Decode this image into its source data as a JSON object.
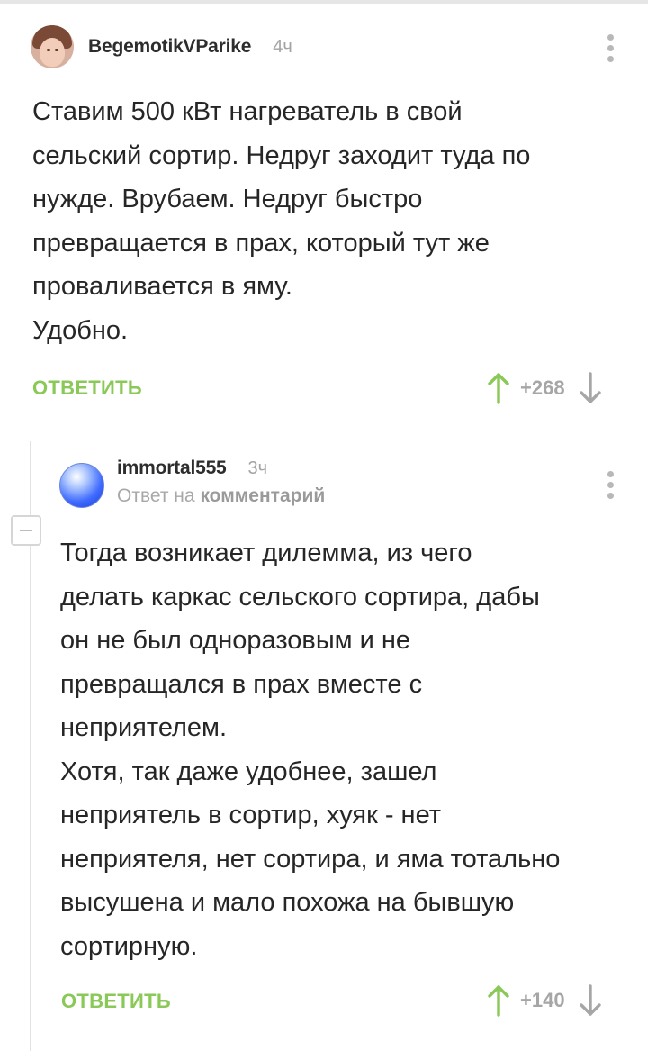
{
  "comment1": {
    "username": "BegemotikVParike",
    "time": "4ч",
    "text": "Ставим 500 кВт нагреватель в свой\nсельский сортир. Недруг заходит туда по\nнужде. Врубаем. Недруг быстро\nпревращается в прах, который тут же\nпроваливается в яму.\nУдобно.",
    "reply_label": "ОТВЕТИТЬ",
    "rating": "+268"
  },
  "comment2": {
    "username": "immortal555",
    "time": "3ч",
    "reply_to_prefix": "Ответ на",
    "reply_to_target": "комментарий",
    "text": "Тогда возникает дилемма, из чего\nделать каркас сельского сортира, дабы\nон не был одноразовым и не\nпревращался в прах вместе с\nнеприятелем.\nХотя, так даже удобнее, зашел\nнеприятель в сортир, хуяк - нет\nнеприятеля, нет сортира, и яма тотально\nвысушена и мало похожа на бывшую\nсортирную.",
    "reply_label": "ОТВЕТИТЬ",
    "rating": "+140"
  },
  "colors": {
    "accent_green": "#8ac858",
    "muted_gray": "#a6a6a6"
  }
}
